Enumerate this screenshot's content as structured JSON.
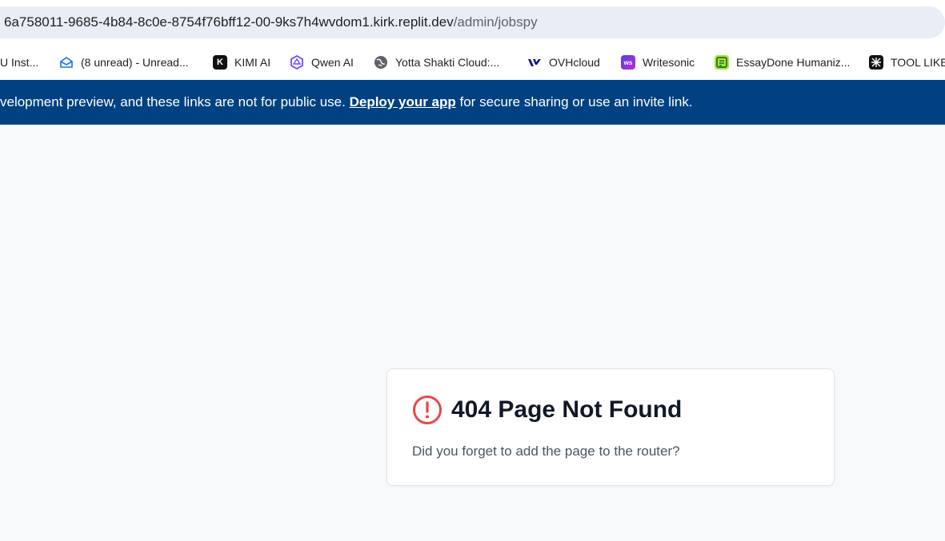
{
  "address_bar": {
    "url_host": "6a758011-9685-4b84-8c0e-8754f76bff12-00-9ks7h4wvdom1.kirk.replit.dev",
    "url_path": "/admin/jobspy"
  },
  "bookmarks": [
    {
      "label": "U Inst...",
      "icon": "bookmark-icon"
    },
    {
      "label": "(8 unread) - Unread...",
      "icon": "mail-icon"
    },
    {
      "label": "KIMI AI",
      "icon": "kimi-icon"
    },
    {
      "label": "Qwen AI",
      "icon": "qwen-icon"
    },
    {
      "label": "Yotta Shakti Cloud:...",
      "icon": "globe-icon"
    },
    {
      "label": "OVHcloud",
      "icon": "ovh-icon"
    },
    {
      "label": "Writesonic",
      "icon": "writesonic-icon"
    },
    {
      "label": "EssayDone Humaniz...",
      "icon": "essaydone-icon"
    },
    {
      "label": "TOOL LIKE",
      "icon": "tool-icon"
    }
  ],
  "banner": {
    "text_before": "velopment preview, and these links are not for public use. ",
    "link_text": "Deploy your app",
    "text_after": " for secure sharing or use an invite link."
  },
  "error_card": {
    "title": "404 Page Not Found",
    "description": "Did you forget to add the page to the router?"
  },
  "colors": {
    "banner_bg": "#004182",
    "alert_red": "#ef4444",
    "page_bg": "#f8f9fb"
  }
}
